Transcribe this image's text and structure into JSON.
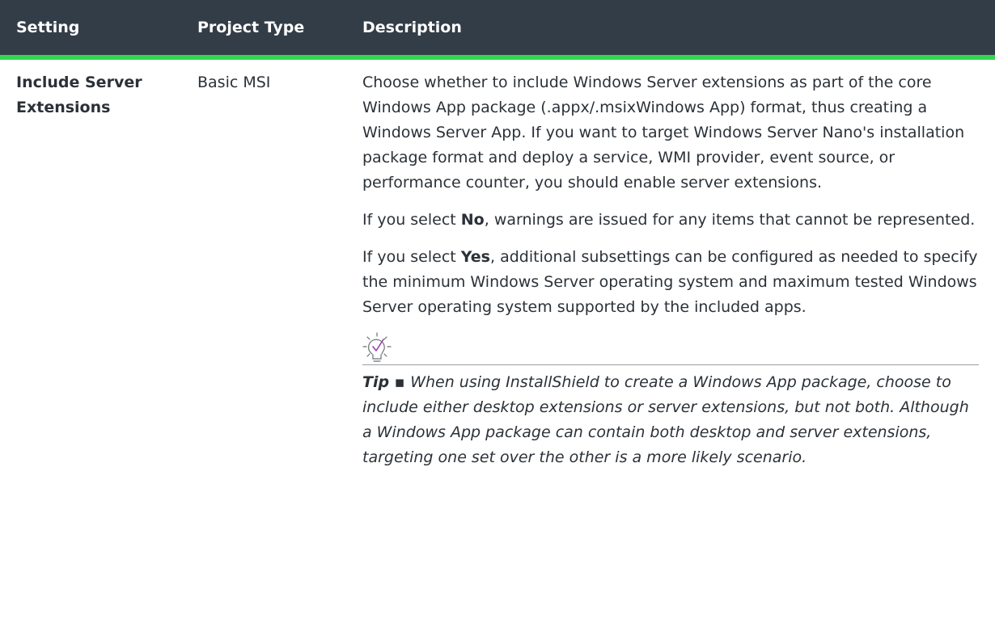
{
  "table": {
    "headers": {
      "setting": "Setting",
      "project_type": "Project Type",
      "description": "Description"
    },
    "rows": [
      {
        "setting": "Include Server Extensions",
        "project_type": "Basic MSI",
        "description": {
          "p1": "Choose whether to include Windows Server extensions as part of the core Windows App package (.appx/.msixWindows App) format, thus creating a Windows Server App. If you want to target Windows Server Nano's installation package format and deploy a service, WMI provider, event source, or performance counter, you should enable server extensions.",
          "p2": {
            "before": "If you select ",
            "bold": "No",
            "after": ", warnings are issued for any items that cannot be represented."
          },
          "p3": {
            "before": "If you select ",
            "bold": "Yes",
            "after": ", additional subsettings can be configured as needed to specify the minimum Windows Server operating system and maximum tested Windows Server operating system supported by the included apps."
          },
          "tip": {
            "icon": "lightbulb-check-icon",
            "label": "Tip",
            "separator": " ▪ ",
            "text": "When using InstallShield to create a Windows App package, choose to include either desktop extensions or server extensions, but not both. Although a Windows App package can contain both desktop and server extensions, targeting one set over the other is a more likely scenario."
          }
        }
      }
    ]
  },
  "colors": {
    "header_bg": "#333d47",
    "header_accent": "#31d651",
    "icon_accent": "#9b3fa8"
  }
}
